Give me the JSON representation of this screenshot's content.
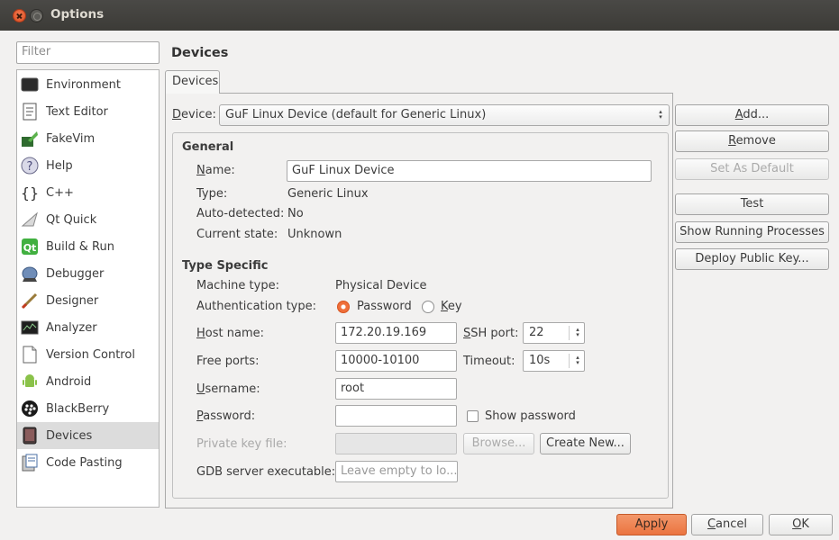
{
  "window": {
    "title": "Options"
  },
  "filter": {
    "placeholder": "Filter"
  },
  "sidebar": {
    "items": [
      {
        "label": "Environment",
        "icon": "monitor-icon"
      },
      {
        "label": "Text Editor",
        "icon": "text-document-icon"
      },
      {
        "label": "FakeVim",
        "icon": "fakevim-icon"
      },
      {
        "label": "Help",
        "icon": "help-icon"
      },
      {
        "label": "C++",
        "icon": "braces-icon"
      },
      {
        "label": "Qt Quick",
        "icon": "qt-quick-icon"
      },
      {
        "label": "Build & Run",
        "icon": "build-run-icon"
      },
      {
        "label": "Debugger",
        "icon": "debugger-icon"
      },
      {
        "label": "Designer",
        "icon": "designer-icon"
      },
      {
        "label": "Analyzer",
        "icon": "analyzer-icon"
      },
      {
        "label": "Version Control",
        "icon": "version-control-icon"
      },
      {
        "label": "Android",
        "icon": "android-icon"
      },
      {
        "label": "BlackBerry",
        "icon": "blackberry-icon"
      },
      {
        "label": "Devices",
        "icon": "devices-icon",
        "selected": true
      },
      {
        "label": "Code Pasting",
        "icon": "code-pasting-icon"
      }
    ]
  },
  "main": {
    "page_title": "Devices",
    "tab_label": "Devices",
    "device_label_prefix": "D",
    "device_label_rest": "evice:",
    "device_value": "GuF Linux Device (default for Generic Linux)",
    "general": {
      "heading": "General",
      "name_label_u": "N",
      "name_label_rest": "ame:",
      "name_value": "GuF Linux Device",
      "type_label": "Type:",
      "type_value": "Generic Linux",
      "autodetected_label": "Auto-detected:",
      "autodetected_value": "No",
      "state_label": "Current state:",
      "state_value": "Unknown"
    },
    "type_specific": {
      "heading": "Type Specific",
      "machine_type_label": "Machine type:",
      "machine_type_value": "Physical Device",
      "auth_label": "Authentication type:",
      "auth_password": "Password",
      "auth_key_u": "K",
      "auth_key_rest": "ey",
      "host_label_u": "H",
      "host_label_rest": "ost name:",
      "host_value": "172.20.19.169",
      "ssh_label_u": "S",
      "ssh_label_rest": "SH port:",
      "ssh_value": "22",
      "free_ports_label": "Free ports:",
      "free_ports_value": "10000-10100",
      "timeout_label": "Timeout:",
      "timeout_value": "10s",
      "username_label_u": "U",
      "username_label_rest": "sername:",
      "username_value": "root",
      "password_label_u": "P",
      "password_label_rest": "assword:",
      "password_value": "",
      "show_password": "Show password",
      "private_key_label": "Private key file:",
      "browse": "Browse...",
      "create_new": "Create New...",
      "gdb_label": "GDB server executable:",
      "gdb_placeholder": "Leave empty to lo..."
    }
  },
  "side_buttons": {
    "add_u": "A",
    "add_rest": "dd...",
    "remove_u": "R",
    "remove_rest": "emove",
    "set_default": "Set As Default",
    "test": "Test",
    "show_processes": "Show Running Processes",
    "deploy_key": "Deploy Public Key..."
  },
  "footer": {
    "apply": "Apply",
    "cancel_u": "C",
    "cancel_rest": "ancel",
    "ok_u": "O",
    "ok_rest": "K"
  },
  "colors": {
    "accent": "#eb7440",
    "titlebar": "#3c3b37",
    "selection": "#dcdcdc"
  }
}
